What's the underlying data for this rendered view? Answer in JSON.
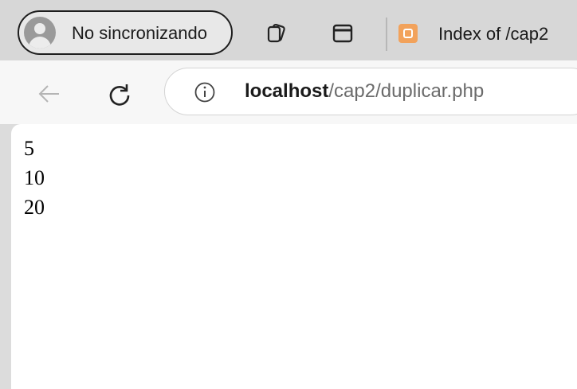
{
  "tabstrip": {
    "profile_label": "No sincronizando",
    "tab_title": "Index of /cap2",
    "icons": [
      "tab-actions-icon",
      "vertical-tabs-icon",
      "xampp-favicon"
    ]
  },
  "toolbar": {
    "icons": [
      "back-arrow-icon",
      "reload-icon",
      "site-info-icon"
    ],
    "url_host": "localhost",
    "url_path": "/cap2/duplicar.php"
  },
  "content": {
    "lines": [
      "5",
      "10",
      "20"
    ]
  }
}
